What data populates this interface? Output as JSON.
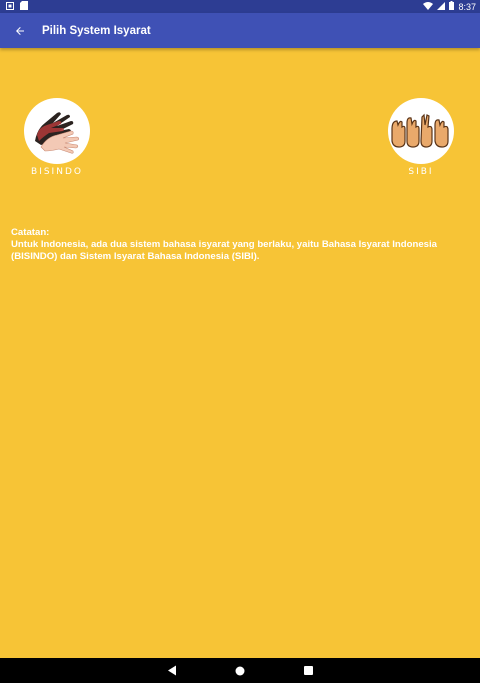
{
  "status_bar": {
    "time": "8:37",
    "icons": [
      "sd-card-icon",
      "wifi-icon",
      "signal-icon",
      "battery-icon"
    ]
  },
  "app_bar": {
    "title": "Pilih System Isyarat",
    "back_icon": "arrow-back-icon"
  },
  "options": [
    {
      "label": "BISINDO",
      "icon": "hands-sign-icon"
    },
    {
      "label": "SIBI",
      "icon": "fingerspelling-icon"
    }
  ],
  "note": {
    "heading": "Catatan:",
    "body": "Untuk Indonesia, ada dua sistem bahasa isyarat yang berlaku, yaitu Bahasa Isyarat Indonesia (BISINDO) dan Sistem Isyarat Bahasa Indonesia (SIBI)."
  },
  "nav_bar": {
    "buttons": [
      "back-triangle-icon",
      "home-circle-icon",
      "recents-square-icon"
    ]
  },
  "colors": {
    "background": "#F7C436",
    "app_bar": "#3F51B5",
    "status_bar": "#2D3D93"
  }
}
